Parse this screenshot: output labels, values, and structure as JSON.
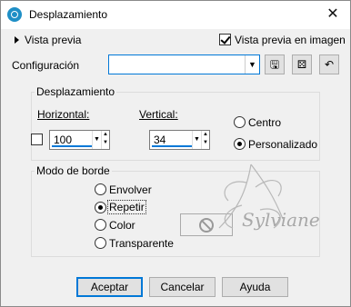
{
  "window": {
    "title": "Desplazamiento",
    "close_glyph": "✕"
  },
  "preview": {
    "label": "Vista previa",
    "image_preview_label": "Vista previa en imagen",
    "image_preview_checked": true
  },
  "config": {
    "label": "Configuración",
    "value": "",
    "buttons": [
      "save-preset-icon",
      "randomize-icon",
      "reset-icon"
    ]
  },
  "offset": {
    "group_title": "Desplazamiento",
    "horizontal_label": "Horizontal:",
    "horizontal_value": "100",
    "vertical_label": "Vertical:",
    "vertical_value": "34",
    "link_checked": false,
    "center_label": "Centro",
    "custom_label": "Personalizado",
    "selected": "Personalizado"
  },
  "edge_mode": {
    "group_title": "Modo de borde",
    "options": [
      "Envolver",
      "Repetir",
      "Color",
      "Transparente"
    ],
    "selected": "Repetir"
  },
  "watermark_text": "Sylviane",
  "buttons": {
    "ok": "Aceptar",
    "cancel": "Cancelar",
    "help": "Ayuda"
  }
}
